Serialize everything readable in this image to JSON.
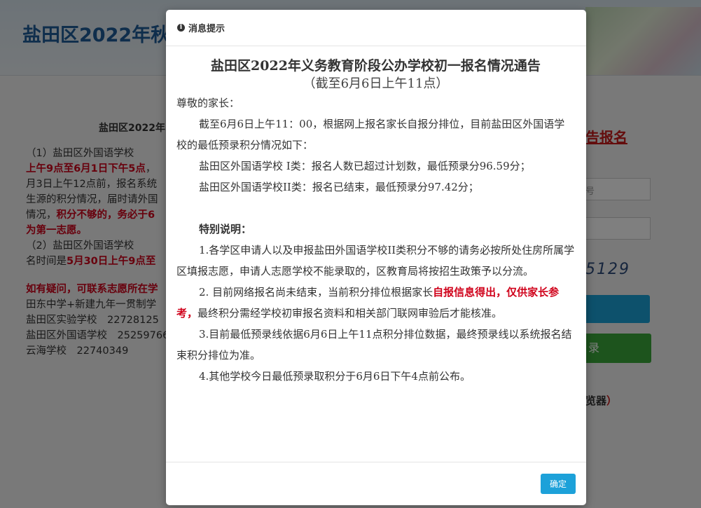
{
  "background": {
    "site_title": "盐田区2022年秋",
    "center_title": "盐田区2022年",
    "left_paragraphs": [
      {
        "parts": [
          {
            "text": "（1）盐田区外国语学校",
            "red": false
          }
        ]
      },
      {
        "parts": [
          {
            "text": "上午9点至6月1日下午5点",
            "red": true
          },
          {
            "text": "，",
            "red": false
          }
        ]
      },
      {
        "parts": [
          {
            "text": "月3日上午12点前，报名系统",
            "red": false
          }
        ]
      },
      {
        "parts": [
          {
            "text": "生源的积分情况，届时请外国",
            "red": false
          }
        ]
      },
      {
        "parts": [
          {
            "text": "情况，",
            "red": false
          },
          {
            "text": "积分不够的，务必于6",
            "red": true
          }
        ]
      },
      {
        "parts": [
          {
            "text": "为第一志愿。",
            "red": true
          }
        ]
      },
      {
        "parts": [
          {
            "text": "（2）盐田区外国语学校",
            "red": false
          }
        ]
      },
      {
        "parts": [
          {
            "text": "名时间是",
            "red": false
          },
          {
            "text": "5月30日上午9点至",
            "red": true
          }
        ]
      }
    ],
    "contact_heading": "如有疑问，可联系志愿所在学",
    "contacts": [
      "田东中学+新建九年一贯制学",
      "盐田区实验学校　22728125",
      "盐田区外国语学校　25259766",
      "云海学校　22740349"
    ],
    "right_link": "告报名",
    "input_placeholder_1": "号",
    "captcha_text": "5129",
    "login_label": "录",
    "browser_note": "览器",
    "browser_paren": "）"
  },
  "modal": {
    "header_title": "消息提示",
    "header_icon": "info-circle-icon",
    "notice_title": "盐田区2022年义务教育阶段公办学校初一报名情况通告",
    "notice_subtitle": "（截至6月6日上午11点）",
    "greeting": "尊敬的家长：",
    "intro": "截至6月6日上午11：00，根据网上报名家长自报分排位，目前盐田区外国语学校的最低预录积分情况如下：",
    "class_one": "盐田区外国语学校 I类：报名人数已超过计划数，最低预录分96.59分；",
    "class_two": "盐田区外国语学校II类：报名已结束，最低预录分97.42分；",
    "special_heading": "特别说明：",
    "note_1": "1.各学区申请人以及申报盐田外国语学校II类积分不够的请务必按所处住房所属学区填报志愿，申请人志愿学校不能录取的，区教育局将按招生政策予以分流。",
    "note_2_before": "2. 目前网络报名尚未结束，当前积分排位根据家长",
    "note_2_red": "自报信息得出，仅供家长参考，",
    "note_2_after": "最终积分需经学校初审报名资料和相关部门联网审验后才能核准。",
    "note_3": "3.目前最低预录线依据6月6日上午11点积分排位数据，最终预录线以系统报名结束积分排位为准。",
    "note_4": "4.其他学校今日最低预录取积分于6月6日下午4点前公布。",
    "ok_label": "确定"
  }
}
